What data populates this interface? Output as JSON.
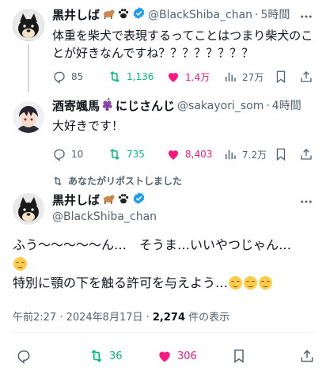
{
  "tweets": [
    {
      "author_name": "黒井しば",
      "handle": "@BlackShiba_chan",
      "separator": "·",
      "time": "5時間",
      "text": "体重を柴犬で表現するってことはつまり柴犬のことが好きなんですね？？？？？？？？",
      "replies": "85",
      "reposts": "1,136",
      "likes": "1.4万",
      "views": "27万"
    },
    {
      "author_name": "酒寄颯馬",
      "author_suffix": "にじさんじ",
      "handle": "@sakayori_som",
      "separator": "·",
      "time": "4時間",
      "text": "大好きです！",
      "replies": "10",
      "reposts": "735",
      "likes": "8,403",
      "views": "7.2万"
    }
  ],
  "repost_banner": "あなたがリポストしました",
  "main_tweet": {
    "author_name": "黒井しば",
    "handle": "@BlackShiba_chan",
    "line1": "ふう～～～～～ん…　そうま…いいやつじゃん…",
    "line2": "特別に顎の下を触る許可を与えよう…",
    "meta_time": "午前2:27 · 2024年8月17日 · ",
    "meta_views": "2,274",
    "meta_views_suffix": " 件の表示",
    "reposts": "36",
    "likes": "306"
  },
  "colors": {
    "text": "#0f1419",
    "secondary": "#536471",
    "verified": "#1d9bf0",
    "repost": "#00ba7c",
    "like": "#f91880"
  }
}
